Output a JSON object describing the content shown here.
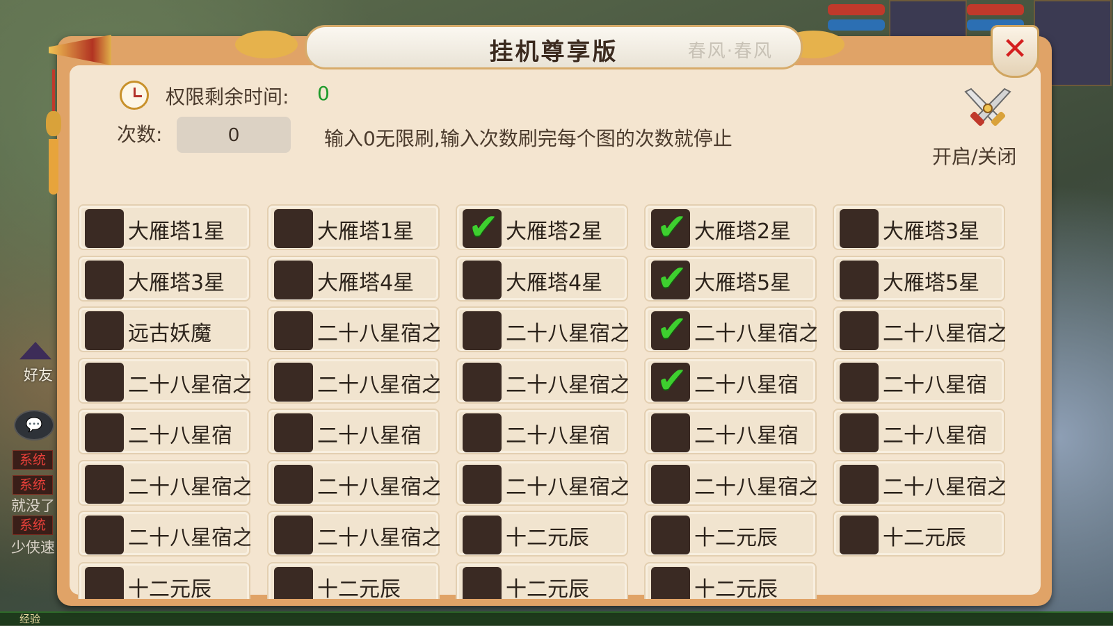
{
  "window": {
    "title": "挂机尊享版",
    "title_deco": "春风·春风",
    "close_symbol": "✕"
  },
  "colors": {
    "panel_border": "#e0a367",
    "panel_fill": "#f4e5d0",
    "checkbox": "#3a2a23",
    "check_mark": "#3ecf2f",
    "time_value": "#1d9a2a",
    "close_x": "#d41f1f"
  },
  "icons": {
    "clock": "clock-icon",
    "toggle": "crossed-swords-icon",
    "close": "close-icon"
  },
  "permission": {
    "label": "权限剩余时间:",
    "value": "0"
  },
  "count": {
    "label": "次数:",
    "value": "0"
  },
  "hint": "输入0无限刷,输入次数刷完每个图的次数就停止",
  "toggle": {
    "label": "开启/关闭"
  },
  "items": [
    {
      "label": "大雁塔1星",
      "checked": false
    },
    {
      "label": "大雁塔1星",
      "checked": false
    },
    {
      "label": "大雁塔2星",
      "checked": true
    },
    {
      "label": "大雁塔2星",
      "checked": true
    },
    {
      "label": "大雁塔3星",
      "checked": false
    },
    {
      "label": "大雁塔3星",
      "checked": false
    },
    {
      "label": "大雁塔4星",
      "checked": false
    },
    {
      "label": "大雁塔4星",
      "checked": false
    },
    {
      "label": "大雁塔5星",
      "checked": true
    },
    {
      "label": "大雁塔5星",
      "checked": false
    },
    {
      "label": "远古妖魔",
      "checked": false
    },
    {
      "label": "二十八星宿之",
      "checked": false
    },
    {
      "label": "二十八星宿之",
      "checked": false
    },
    {
      "label": "二十八星宿之",
      "checked": true
    },
    {
      "label": "二十八星宿之",
      "checked": false
    },
    {
      "label": "二十八星宿之",
      "checked": false
    },
    {
      "label": "二十八星宿之",
      "checked": false
    },
    {
      "label": "二十八星宿之",
      "checked": false
    },
    {
      "label": "二十八星宿",
      "checked": true
    },
    {
      "label": "二十八星宿",
      "checked": false
    },
    {
      "label": "二十八星宿",
      "checked": false
    },
    {
      "label": "二十八星宿",
      "checked": false
    },
    {
      "label": "二十八星宿",
      "checked": false
    },
    {
      "label": "二十八星宿",
      "checked": false
    },
    {
      "label": "二十八星宿",
      "checked": false
    },
    {
      "label": "二十八星宿之",
      "checked": false
    },
    {
      "label": "二十八星宿之",
      "checked": false
    },
    {
      "label": "二十八星宿之",
      "checked": false
    },
    {
      "label": "二十八星宿之",
      "checked": false
    },
    {
      "label": "二十八星宿之",
      "checked": false
    },
    {
      "label": "二十八星宿之",
      "checked": false
    },
    {
      "label": "二十八星宿之",
      "checked": false
    },
    {
      "label": "十二元辰",
      "checked": false
    },
    {
      "label": "十二元辰",
      "checked": false
    },
    {
      "label": "十二元辰",
      "checked": false
    },
    {
      "label": "十二元辰",
      "checked": false
    },
    {
      "label": "十二元辰",
      "checked": false
    },
    {
      "label": "十二元辰",
      "checked": false
    },
    {
      "label": "十二元辰",
      "checked": false
    }
  ],
  "background_hud": {
    "friend_label": "好友",
    "chat_symbol": "💬",
    "system_tag": "系统",
    "chat_lines": [
      "就没了",
      "少侠速"
    ],
    "exp_label": "经验"
  }
}
